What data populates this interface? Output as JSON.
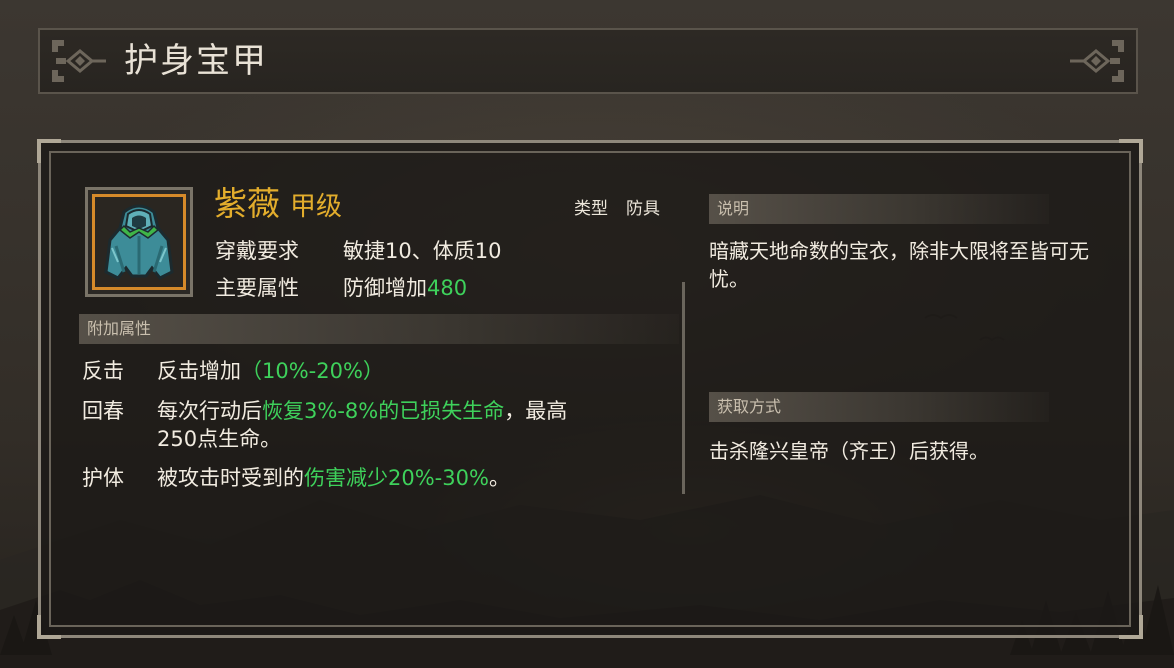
{
  "title": "护身宝甲",
  "item": {
    "name": "紫薇",
    "grade": "甲级",
    "type_label": "类型",
    "type_value": "防具",
    "icon": "cloak-armor-icon",
    "rarity_color": "#d68a2a"
  },
  "requirements": {
    "label": "穿戴要求",
    "value": "敏捷10、体质10"
  },
  "main_attribute": {
    "label": "主要属性",
    "text": "防御增加",
    "value": "480"
  },
  "extra_attributes": {
    "header": "附加属性",
    "items": [
      {
        "name": "反击",
        "text": "反击增加",
        "highlight": "（10%-20%）"
      },
      {
        "name": "回春",
        "text_before": "每次行动后",
        "highlight": "恢复3%-8%的已损失生命",
        "text_after": "，最高",
        "line2": "250点生命。"
      },
      {
        "name": "护体",
        "text_before": "被攻击时受到的",
        "highlight": "伤害减少20%-30%",
        "text_after": "。"
      }
    ]
  },
  "description": {
    "header": "说明",
    "text": "暗藏天地命数的宝衣，除非大限将至皆可无忧。"
  },
  "acquisition": {
    "header": "获取方式",
    "text": "击杀隆兴皇帝（齐王）后获得。"
  },
  "colors": {
    "gold": "#e3ad2c",
    "label": "#d9b46d",
    "highlight": "#3ed15b",
    "text": "#f1ebe0"
  }
}
